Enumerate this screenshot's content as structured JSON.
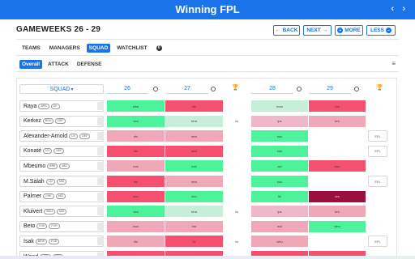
{
  "app": {
    "title": "Winning FPL"
  },
  "nav": {
    "prev": "‹",
    "next": "›"
  },
  "header": {
    "title": "GAMEWEEKS 26 - 29",
    "back": "BACK",
    "next": "NEXT",
    "more": "MORE",
    "less": "LESS"
  },
  "tabs": [
    {
      "label": "TEAMS"
    },
    {
      "label": "MANAGERS"
    },
    {
      "label": "SQUAD"
    },
    {
      "label": "WATCHLIST"
    }
  ],
  "watchlist_count": "0",
  "subtabs": [
    {
      "label": "Overall"
    },
    {
      "label": "ATTACK"
    },
    {
      "label": "DEFENSE"
    }
  ],
  "table": {
    "squad_header": "SQUAD",
    "gameweeks": [
      "26",
      "27",
      "28",
      "29"
    ]
  },
  "colors": {
    "accent": "#1a73e8",
    "green_strong": "#4cf39a",
    "green_light": "#c7eed8",
    "pink_strong": "#f5506f",
    "pink_light": "#f0a8b8",
    "red_dark": "#9c0f3a"
  },
  "players": [
    {
      "name": "Raya",
      "tags": [
        "ars",
        "gk"
      ],
      "cells": [
        {
          "t": "whu",
          "c": "#4cf39a"
        },
        {
          "t": "nfo",
          "c": "#f5506f"
        },
        null,
        {
          "t": "mun",
          "c": "#c7eed8"
        },
        {
          "t": "che",
          "c": "#f5506f"
        }
      ],
      "extra": null
    },
    {
      "name": "Kerkez",
      "tags": [
        "bou",
        "def"
      ],
      "cells": [
        {
          "t": "wol",
          "c": "#4cf39a"
        },
        {
          "t": "bha",
          "c": "#c7eed8"
        },
        {
          "t": "fa",
          "c": null
        },
        {
          "t": "ips",
          "c": "#f0b8c6"
        },
        {
          "t": "bre",
          "c": "#f0a8b8"
        }
      ],
      "extra": null
    },
    {
      "name": "Alexander-Arnold",
      "tags": [
        "liv",
        "def"
      ],
      "cells": [
        {
          "t": "nfo",
          "c": "#f0a8b8"
        },
        {
          "t": "new",
          "c": "#f0a8b8"
        },
        null,
        {
          "t": "sou",
          "c": "#4cf39a"
        },
        null
      ],
      "extra": "efl"
    },
    {
      "name": "Konaté",
      "tags": [
        "liv",
        "def"
      ],
      "cells": [
        {
          "t": "nfo",
          "c": "#f5506f"
        },
        {
          "t": "new",
          "c": "#f5506f"
        },
        null,
        {
          "t": "sou",
          "c": "#4cf39a"
        },
        null
      ],
      "extra": "efl"
    },
    {
      "name": "Mbeumo",
      "tags": [
        "bre",
        "mid"
      ],
      "cells": [
        {
          "t": "eve",
          "c": "#f0a8b8"
        },
        {
          "t": "eve",
          "c": "#4cf39a"
        },
        null,
        {
          "t": "avl",
          "c": "#4cf39a"
        },
        {
          "t": "bou",
          "c": "#f5506f"
        }
      ],
      "extra": null
    },
    {
      "name": "M.Salah",
      "tags": [
        "liv",
        "mid"
      ],
      "cells": [
        {
          "t": "nfo",
          "c": "#f5506f"
        },
        {
          "t": "new",
          "c": "#f0a8b8"
        },
        null,
        {
          "t": "sou",
          "c": "#4cf39a"
        },
        null
      ],
      "extra": "efl"
    },
    {
      "name": "Palmer",
      "tags": [
        "che",
        "mid"
      ],
      "cells": [
        {
          "t": "sou",
          "c": "#f5506f"
        },
        {
          "t": "sou",
          "c": "#4cf39a"
        },
        null,
        {
          "t": "lei",
          "c": "#4cf39a"
        },
        {
          "t": "ars",
          "c": "#9c0f3a"
        }
      ],
      "extra": null
    },
    {
      "name": "Kluivert",
      "tags": [
        "bou",
        "mid"
      ],
      "cells": [
        {
          "t": "wol",
          "c": "#4cf39a"
        },
        {
          "t": "bha",
          "c": "#c7eed8"
        },
        {
          "t": "fa",
          "c": null
        },
        {
          "t": "ips",
          "c": "#f0b8c6"
        },
        {
          "t": "bre",
          "c": "#f0a8b8"
        }
      ],
      "extra": null
    },
    {
      "name": "Beto",
      "tags": [
        "eve",
        "for"
      ],
      "cells": [
        {
          "t": "mun",
          "c": "#f0a8b8"
        },
        {
          "t": "bre",
          "c": "#f0a8b8"
        },
        null,
        {
          "t": "wol",
          "c": "#f0a8b8"
        },
        {
          "t": "whu",
          "c": "#4cf39a"
        }
      ],
      "extra": null
    },
    {
      "name": "Isak",
      "tags": [
        "new",
        "for"
      ],
      "cells": [
        {
          "t": "nfo",
          "c": "#f0a8b8"
        },
        {
          "t": "liv",
          "c": "#f5506f"
        },
        {
          "t": "fa",
          "c": null
        },
        {
          "t": "whu",
          "c": "#f0a8b8"
        },
        null
      ],
      "extra": "efl"
    },
    {
      "name": "Wood",
      "tags": [
        "nfo",
        "for"
      ],
      "cells": [
        {
          "t": "new",
          "c": "#f5506f"
        },
        {
          "t": "ars",
          "c": "#f5506f"
        },
        null,
        {
          "t": "ips",
          "c": "#f5506f"
        },
        {
          "t": "mci",
          "c": "#f5506f"
        }
      ],
      "extra": null
    }
  ]
}
